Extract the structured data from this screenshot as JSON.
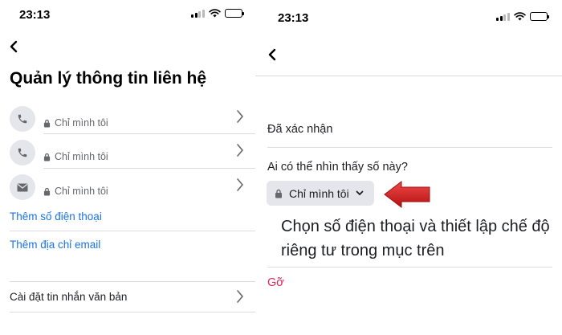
{
  "colors": {
    "link_blue": "#1b74e4",
    "remove_red": "#e0245e",
    "divider": "#dadde1",
    "icon_bg": "#e4e6eb",
    "arrow_red": "#d91f1f"
  },
  "left_screen": {
    "status_time": "23:13",
    "back_icon": "chevron-left-icon",
    "title": "Quản lý thông tin liên hệ",
    "contacts": [
      {
        "icon": "phone-icon",
        "privacy": "Chỉ mình tôi"
      },
      {
        "icon": "phone-icon",
        "privacy": "Chỉ mình tôi"
      },
      {
        "icon": "envelope-icon",
        "privacy": "Chỉ mình tôi"
      }
    ],
    "add_phone": "Thêm số điện thoại",
    "add_email": "Thêm địa chỉ email",
    "text_settings": "Cài đặt tin nhắn văn bản"
  },
  "right_screen": {
    "status_time": "23:13",
    "back_icon": "chevron-left-icon",
    "verified": "Đã xác nhận",
    "question": "Ai có thể nhìn thấy số này?",
    "privacy_value": "Chỉ mình tôi",
    "instruction": "Chọn số điện thoại và thiết lập chế độ riêng tư trong mục trên",
    "remove": "Gỡ"
  }
}
